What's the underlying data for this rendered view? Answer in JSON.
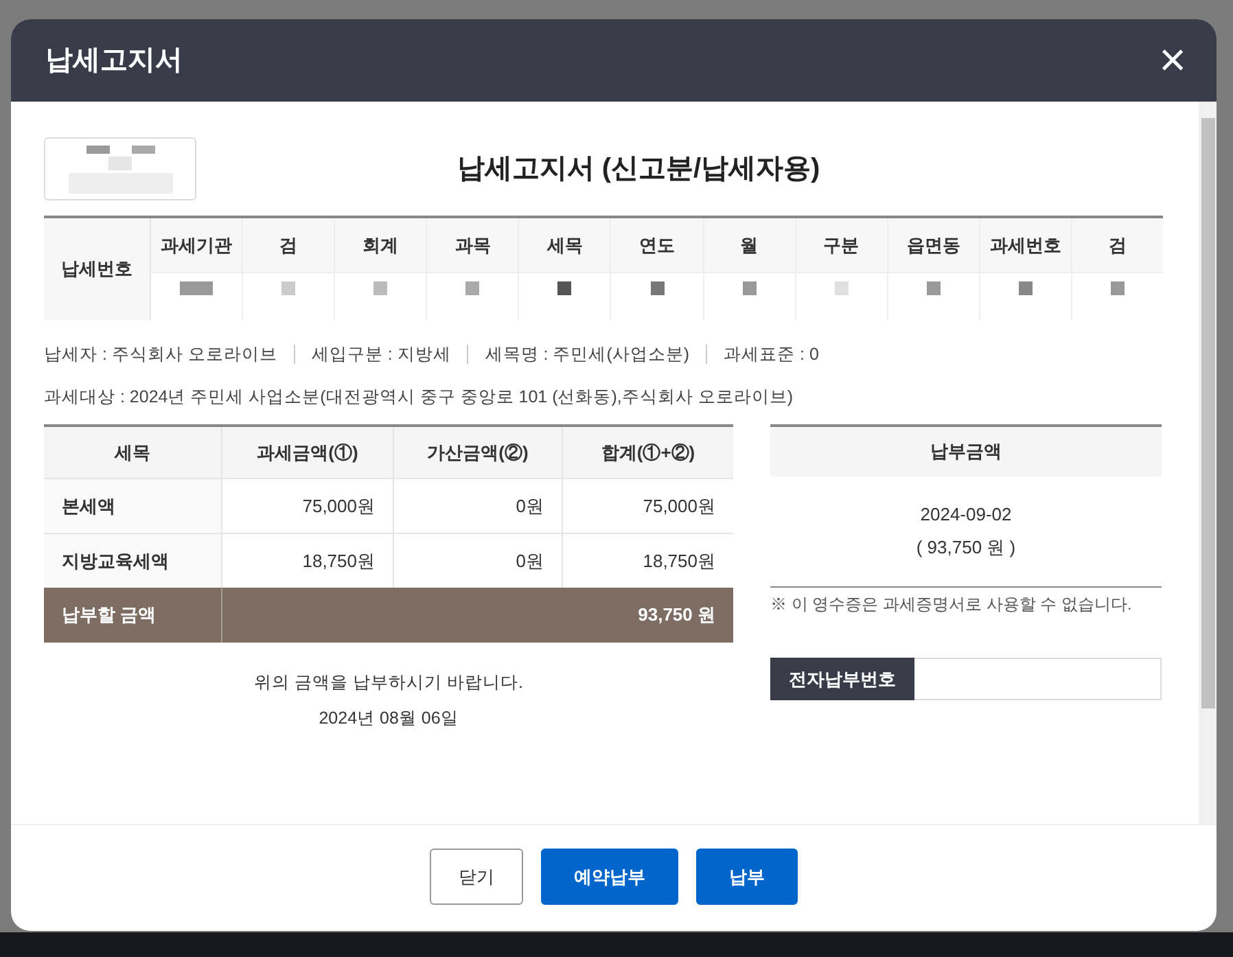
{
  "dialog": {
    "title": "납세고지서",
    "close": "×"
  },
  "notice": {
    "title": "납세고지서 (신고분/납세자용)",
    "tax_number": {
      "label": "납세번호",
      "columns": [
        "과세기관",
        "검",
        "회계",
        "과목",
        "세목",
        "연도",
        "월",
        "구분",
        "읍면동",
        "과세번호",
        "검"
      ]
    },
    "info": [
      "납세자 : 주식회사 오로라이브",
      "세입구분 : 지방세",
      "세목명 : 주민세(사업소분)",
      "과세표준 : 0"
    ],
    "subject": "과세대상 : 2024년 주민세 사업소분(대전광역시 중구 중앙로 101 (선화동),주식회사 오로라이브)",
    "table": {
      "columns": [
        "세목",
        "과세금액(①)",
        "가산금액(②)",
        "합계(①+②)"
      ],
      "rows": [
        [
          "본세액",
          "75,000원",
          "0원",
          "75,000원"
        ],
        [
          "지방교육세액",
          "18,750원",
          "0원",
          "18,750원"
        ]
      ],
      "total": {
        "label": "납부할 금액",
        "value": "93,750 원"
      }
    },
    "payment": {
      "header": "납부금액",
      "date": "2024-09-02",
      "amount": "( 93,750 원 )",
      "note": "※ 이 영수증은 과세증명서로 사용할 수 없습니다.",
      "epay_label": "전자납부번호"
    },
    "request": "위의 금액을 납부하시기 바랍니다.",
    "issue_date": "2024년 08월 06일"
  },
  "buttons": [
    {
      "label": "닫기",
      "kind": "secondary"
    },
    {
      "label": "예약납부",
      "kind": "primary"
    },
    {
      "label": "납부",
      "kind": "primary"
    }
  ]
}
